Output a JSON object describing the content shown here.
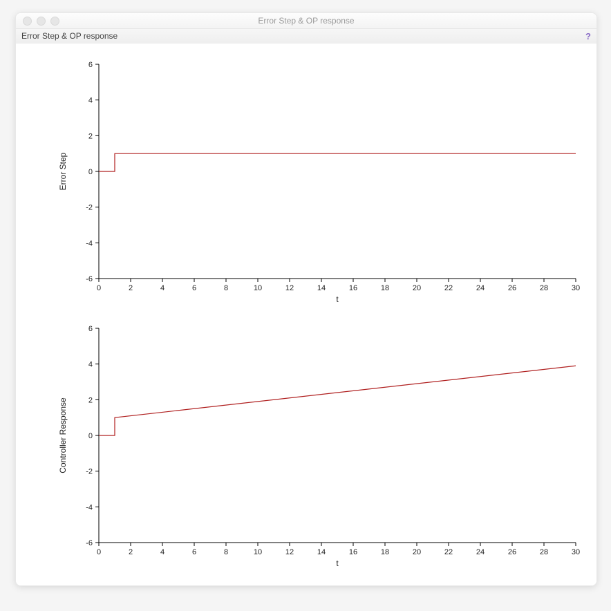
{
  "window": {
    "title": "Error Step & OP response",
    "panel_title": "Error Step & OP response",
    "help_symbol": "?"
  },
  "chart_data": [
    {
      "type": "line",
      "ylabel": "Error Step",
      "xlabel": "t",
      "xlim": [
        0,
        30
      ],
      "ylim": [
        -6,
        6
      ],
      "xticks": [
        0,
        2,
        4,
        6,
        8,
        10,
        12,
        14,
        16,
        18,
        20,
        22,
        24,
        26,
        28,
        30
      ],
      "yticks": [
        -6,
        -4,
        -2,
        0,
        2,
        4,
        6
      ],
      "series": [
        {
          "name": "error-step",
          "x": [
            0,
            1,
            1,
            30
          ],
          "y": [
            0,
            0,
            1,
            1
          ]
        }
      ]
    },
    {
      "type": "line",
      "ylabel": "Controller Response",
      "xlabel": "t",
      "xlim": [
        0,
        30
      ],
      "ylim": [
        -6,
        6
      ],
      "xticks": [
        0,
        2,
        4,
        6,
        8,
        10,
        12,
        14,
        16,
        18,
        20,
        22,
        24,
        26,
        28,
        30
      ],
      "yticks": [
        -6,
        -4,
        -2,
        0,
        2,
        4,
        6
      ],
      "series": [
        {
          "name": "controller-response",
          "x": [
            0,
            1,
            1,
            30
          ],
          "y": [
            0,
            0,
            1,
            3.9
          ]
        }
      ]
    }
  ]
}
